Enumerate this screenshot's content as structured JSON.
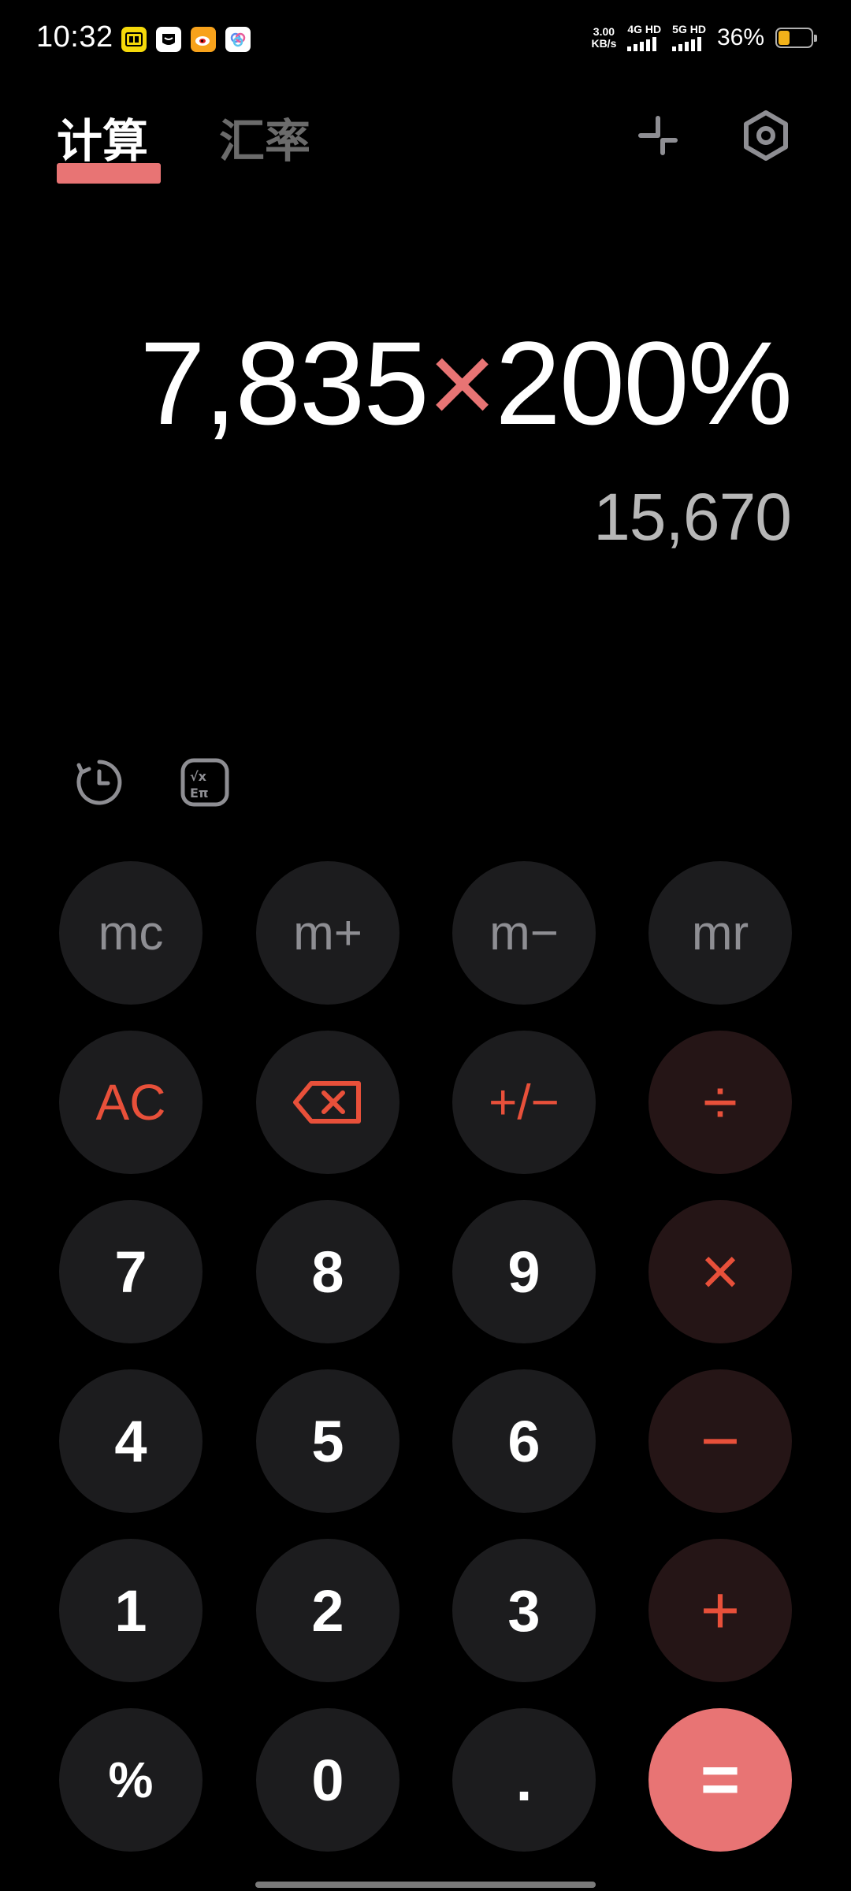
{
  "status_bar": {
    "time": "10:32",
    "net_speed_value": "3.00",
    "net_speed_unit": "KB/s",
    "sim1_label": "4G HD",
    "sim2_label": "5G HD",
    "battery_percent": "36%",
    "battery_level": 0.36
  },
  "header": {
    "tab_calculate": "计算",
    "tab_exchange": "汇率",
    "accent_color": "#e87474"
  },
  "display": {
    "operand1": "7,835",
    "operator": "×",
    "operand2": "200%",
    "result": "15,670"
  },
  "keypad": {
    "mc": "mc",
    "m_plus": "m+",
    "m_minus": "m−",
    "mr": "mr",
    "ac": "AC",
    "plus_minus": "+/−",
    "divide": "÷",
    "seven": "7",
    "eight": "8",
    "nine": "9",
    "multiply": "×",
    "four": "4",
    "five": "5",
    "six": "6",
    "minus": "−",
    "one": "1",
    "two": "2",
    "three": "3",
    "plus": "+",
    "percent": "%",
    "zero": "0",
    "dot": ".",
    "equals": "="
  },
  "icons": {
    "minimize": "collapse-arrows-icon",
    "settings": "hexagon-gear-icon",
    "history": "history-clock-icon",
    "scientific": "scientific-functions-icon",
    "backspace": "backspace-icon"
  }
}
